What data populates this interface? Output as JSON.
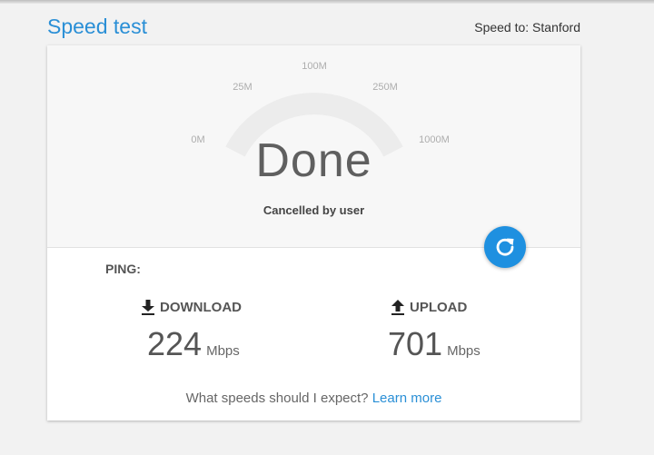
{
  "header": {
    "title": "Speed test",
    "speed_to": "Speed to: Stanford"
  },
  "gauge": {
    "ticks": [
      "0M",
      "25M",
      "100M",
      "250M",
      "1000M"
    ],
    "status": "Done",
    "substatus": "Cancelled by user"
  },
  "results": {
    "ping_label": "PING:",
    "download_label": "DOWNLOAD",
    "download_value": "224",
    "download_unit": "Mbps",
    "upload_label": "UPLOAD",
    "upload_value": "701",
    "upload_unit": "Mbps"
  },
  "footer": {
    "question": "What speeds should I expect?",
    "link": "Learn more"
  },
  "colors": {
    "accent": "#2a8fd6",
    "button": "#1e90e0"
  },
  "icons": [
    "refresh-icon",
    "download-icon",
    "upload-icon"
  ]
}
